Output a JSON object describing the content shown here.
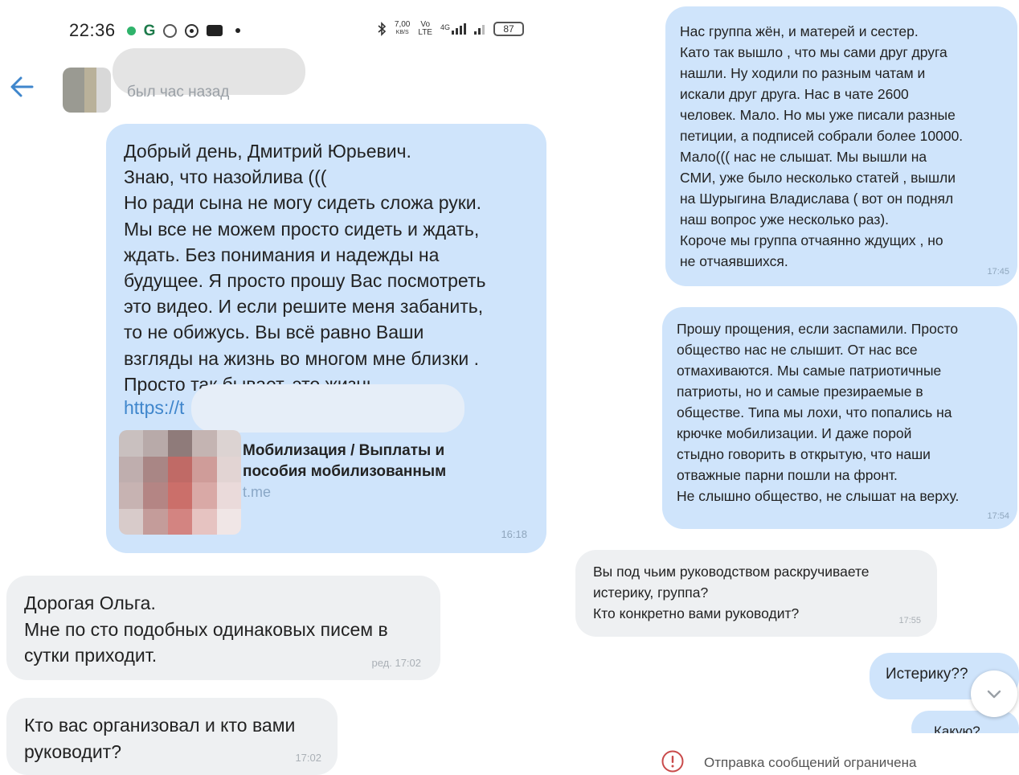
{
  "status_bar": {
    "time": "22:36",
    "speed_value": "7,00",
    "speed_unit": "KB/S",
    "net1": "Vo\nLTE",
    "net2": "4G",
    "battery": "87"
  },
  "header": {
    "last_seen": "был час назад"
  },
  "left_messages": [
    {
      "text": "Добрый день, Дмитрий Юрьевич.\nЗнаю, что назойлива (((\nНо ради сына не могу сидеть сложа руки.\nМы все не можем просто сидеть и ждать,\nждать. Без понимания и надежды на\nбудущее. Я просто прошу Вас посмотреть\nэто видео. И если решите меня забанить,\nто не обижусь. Вы всё равно Ваши\nвзгляды на жизнь во многом мне близки .\nПросто так бывает, это жизнь...",
      "link": "https://t",
      "preview_title": "Мобилизация / Выплаты и\nпособия мобилизованным",
      "preview_domain": "t.me",
      "time": "16:18"
    },
    {
      "text": "Дорогая Ольга.\nМне по сто подобных одинаковых писем в\nсутки приходит.",
      "time": "ред. 17:02"
    },
    {
      "text": "Кто вас организовал и кто вами\nруководит?",
      "time": "17:02"
    }
  ],
  "right_messages": [
    {
      "text": "Нас группа жён, и матерей и сестер.\nКато так вышло , что мы сами друг друга\nнашли. Ну ходили по разным чатам и\nискали друг друга. Нас в чате 2600\nчеловек. Мало. Но мы уже писали разные\nпетиции, а подписей собрали более 10000.\nМало((( нас не слышат. Мы вышли на\nСМИ, уже было несколько статей , вышли\nна Шурыгина Владислава  ( вот он поднял\nнаш вопрос уже несколько раз).\nКороче мы группа отчаянно ждущих , но\nне отчаявшихся.",
      "time": "17:45"
    },
    {
      "text": "Прошу прощения, если заспамили. Просто\nобщество нас не слышит. От нас все\nотмахиваются. Мы самые патриотичные\nпатриоты, но и самые презираемые в\nобществе. Типа мы лохи, что попались на\nкрючке мобилизации. И даже порой\nстыдно говорить в открытую, что наши\nотважные парни пошли на фронт.\nНе слышно общество, не слышат на верху.",
      "time": "17:54"
    },
    {
      "text": "Вы под чьим руководством раскручиваете\nистерику, группа?\nКто конкретно вами руководит?",
      "time": "17:55"
    },
    {
      "text": "Истерику??"
    },
    {
      "text": "Какую?"
    }
  ],
  "restriction_notice": "Отправка сообщений ограничена",
  "colors": {
    "outgoing_bubble": "#cfe4fb",
    "incoming_bubble": "#eef0f2",
    "link": "#3f86cc",
    "accent": "#3f86cc",
    "warning": "#c94a4a"
  },
  "icons": {
    "back": "back-arrow-icon",
    "scroll": "chevron-down-icon",
    "restriction": "exclamation-circle-icon"
  }
}
